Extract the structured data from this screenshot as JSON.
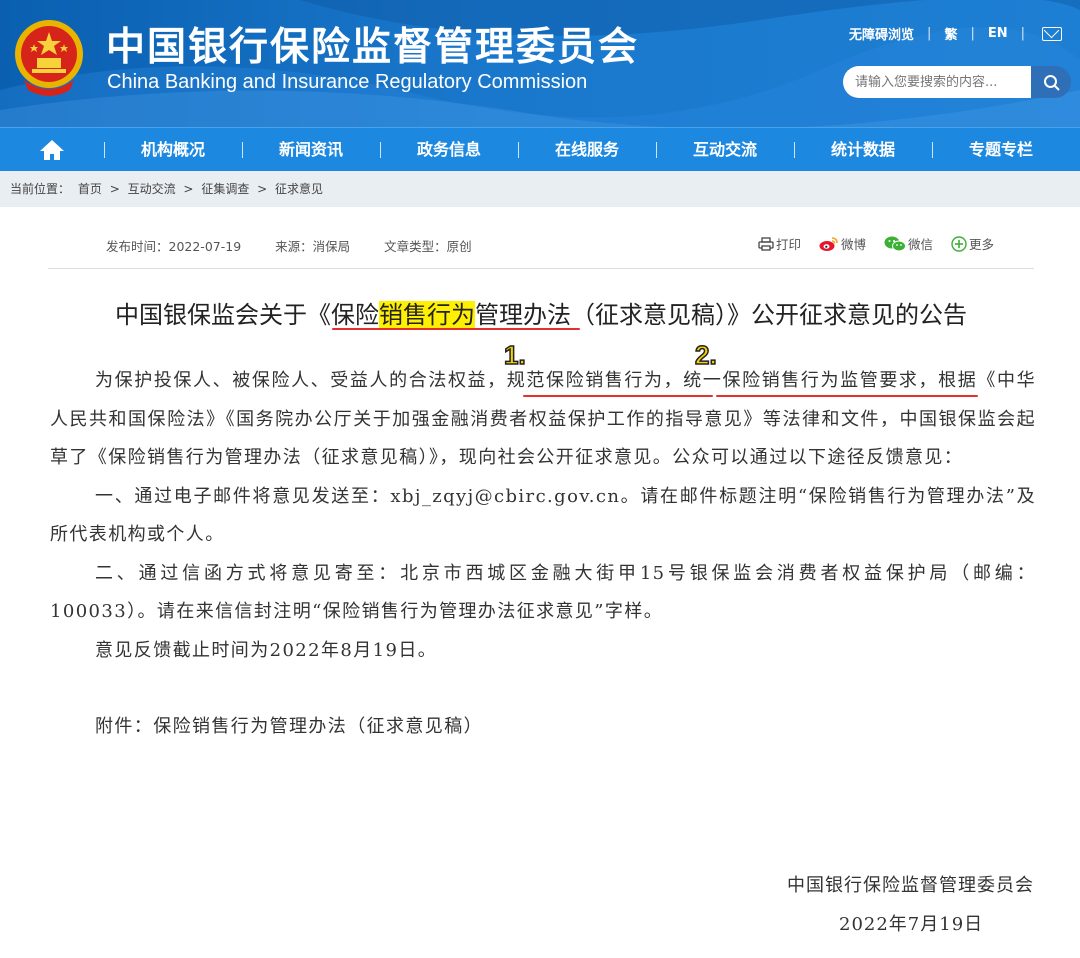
{
  "header": {
    "title_cn": "中国银行保险监督管理委员会",
    "title_en": "China Banking and Insurance Regulatory Commission",
    "links": [
      "无障碍浏览",
      "繁",
      "EN"
    ],
    "search_placeholder": "请输入您要搜索的内容...",
    "icons": [
      "national-emblem",
      "mail-icon",
      "search-icon"
    ],
    "colors": {
      "header": "#1a78cc",
      "nav": "#1c88e0"
    }
  },
  "nav": {
    "items": [
      "机构概况",
      "新闻资讯",
      "政务信息",
      "在线服务",
      "互动交流",
      "统计数据",
      "专题专栏"
    ]
  },
  "breadcrumb": {
    "label": "当前位置：",
    "items": [
      "首页",
      "互动交流",
      "征集调查",
      "征求意见"
    ],
    "separator": ">"
  },
  "meta": {
    "date": "发布时间：2022-07-19",
    "source": "来源：消保局",
    "type": "文章类型：原创"
  },
  "share": {
    "print": "打印",
    "weibo": "微博",
    "wechat": "微信",
    "more": "更多"
  },
  "article": {
    "title_pre": "中国银保监会关于《保险",
    "title_highlight": "销售行为",
    "title_post": "管理办法（征求意见稿）》公开征求意见的公告",
    "p1_a": "为保护投保人、被保险人、受益人的合法权益，",
    "p1_b": "规范保险销售行为",
    "p1_c": "，",
    "p1_d": "统一保险销售行为监管要求",
    "p1_e": "，根据《中华人民共和国保险法》《国务院办公厅关于加强金融消费者权益保护工作的指导意见》等法律和文件，中国银保监会起草了《保险销售行为管理办法（征求意见稿）》，现向社会公开征求意见。公众可以通过以下途径反馈意见：",
    "p2": "一、通过电子邮件将意见发送至：xbj_zqyj@cbirc.gov.cn。请在邮件标题注明“保险销售行为管理办法”及所代表机构或个人。",
    "p3": "二、通过信函方式将意见寄至：北京市西城区金融大街甲15号银保监会消费者权益保护局（邮编：100033）。请在来信信封注明“保险销售行为管理办法征求意见”字样。",
    "p4": "意见反馈截止时间为2022年8月19日。",
    "attachment": "附件：保险销售行为管理办法（征求意见稿）",
    "signature": "中国银行保险监督管理委员会",
    "sign_date": "2022年7月19日"
  },
  "annotations": {
    "mark1": "1.",
    "mark2": "2.",
    "colors": {
      "mark": "#f6d100",
      "underline": "#e53030",
      "highlight": "#ffef00"
    }
  }
}
